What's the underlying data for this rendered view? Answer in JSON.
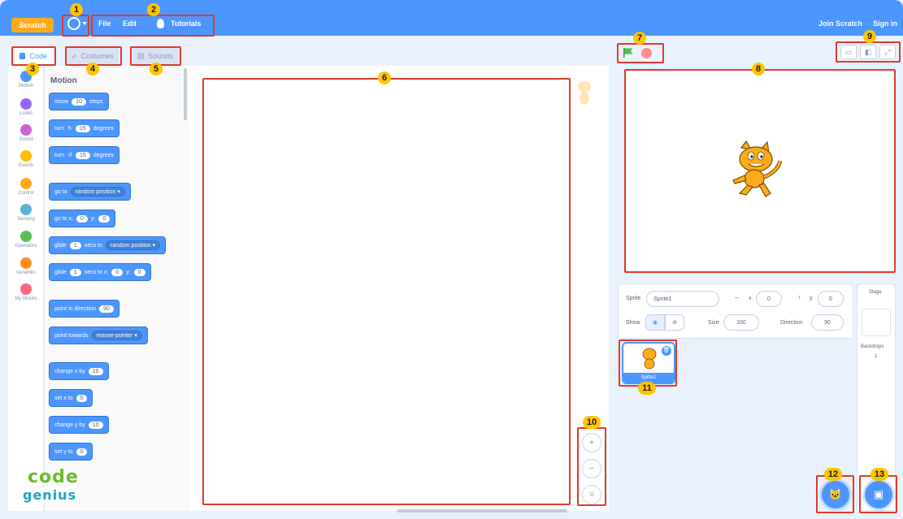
{
  "menubar": {
    "logo": "Scratch",
    "file": "File",
    "edit": "Edit",
    "tutorials": "Tutorials",
    "join": "Join Scratch",
    "signin": "Sign in"
  },
  "tabs": {
    "code": "Code",
    "costumes": "Costumes",
    "sounds": "Sounds"
  },
  "categories": [
    {
      "label": "Motion",
      "color": "#4c97ff"
    },
    {
      "label": "Looks",
      "color": "#9966ff"
    },
    {
      "label": "Sound",
      "color": "#cf63cf"
    },
    {
      "label": "Events",
      "color": "#ffbf00"
    },
    {
      "label": "Control",
      "color": "#ffab19"
    },
    {
      "label": "Sensing",
      "color": "#5cb1d6"
    },
    {
      "label": "Operators",
      "color": "#59c059"
    },
    {
      "label": "Variables",
      "color": "#ff8c1a"
    },
    {
      "label": "My Blocks",
      "color": "#ff6680"
    }
  ],
  "palette": {
    "title": "Motion",
    "move": {
      "a": "move",
      "v": "10",
      "b": "steps"
    },
    "turn_right": {
      "a": "turn",
      "icon": "↻",
      "v": "15",
      "b": "degrees"
    },
    "turn_left": {
      "a": "turn",
      "icon": "↺",
      "v": "15",
      "b": "degrees"
    },
    "goto": {
      "a": "go to",
      "d": "random position ▾"
    },
    "goto_xy": {
      "a": "go to x:",
      "x": "0",
      "b": "y:",
      "y": "0"
    },
    "glide": {
      "a": "glide",
      "v": "1",
      "b": "secs to",
      "d": "random position ▾"
    },
    "glide_xy": {
      "a": "glide",
      "v": "1",
      "b": "secs to x:",
      "x": "0",
      "c": "y:",
      "y": "0"
    },
    "point_dir": {
      "a": "point in direction",
      "v": "90"
    },
    "point_towards": {
      "a": "point towards",
      "d": "mouse-pointer ▾"
    },
    "change_x": {
      "a": "change x by",
      "v": "10"
    },
    "set_x": {
      "a": "set x to",
      "v": "0"
    },
    "change_y": {
      "a": "change y by",
      "v": "10"
    },
    "set_y": {
      "a": "set y to",
      "v": "0"
    }
  },
  "zoom": {
    "in": "+",
    "out": "−",
    "reset": "="
  },
  "sprite_info": {
    "sprite_label": "Sprite",
    "sprite_name": "Sprite1",
    "x_label": "x",
    "x_value": "0",
    "y_label": "y",
    "y_value": "0",
    "show_label": "Show",
    "size_label": "Size",
    "size_value": "100",
    "direction_label": "Direction",
    "direction_value": "90"
  },
  "sprite_tile": {
    "label": "Sprite1",
    "trash": "🗑"
  },
  "stage_pane": {
    "title": "Stage",
    "backdrops_label": "Backdrops",
    "backdrops_count": "1"
  },
  "annotations": [
    "1",
    "2",
    "3",
    "4",
    "5",
    "6",
    "7",
    "8",
    "9",
    "10",
    "11",
    "12",
    "13"
  ],
  "watermark": {
    "line1": "code",
    "line2": "genius"
  },
  "colors": {
    "accent": "#4c97ff",
    "highlight": "#e0392b",
    "badge": "#ffc400"
  }
}
